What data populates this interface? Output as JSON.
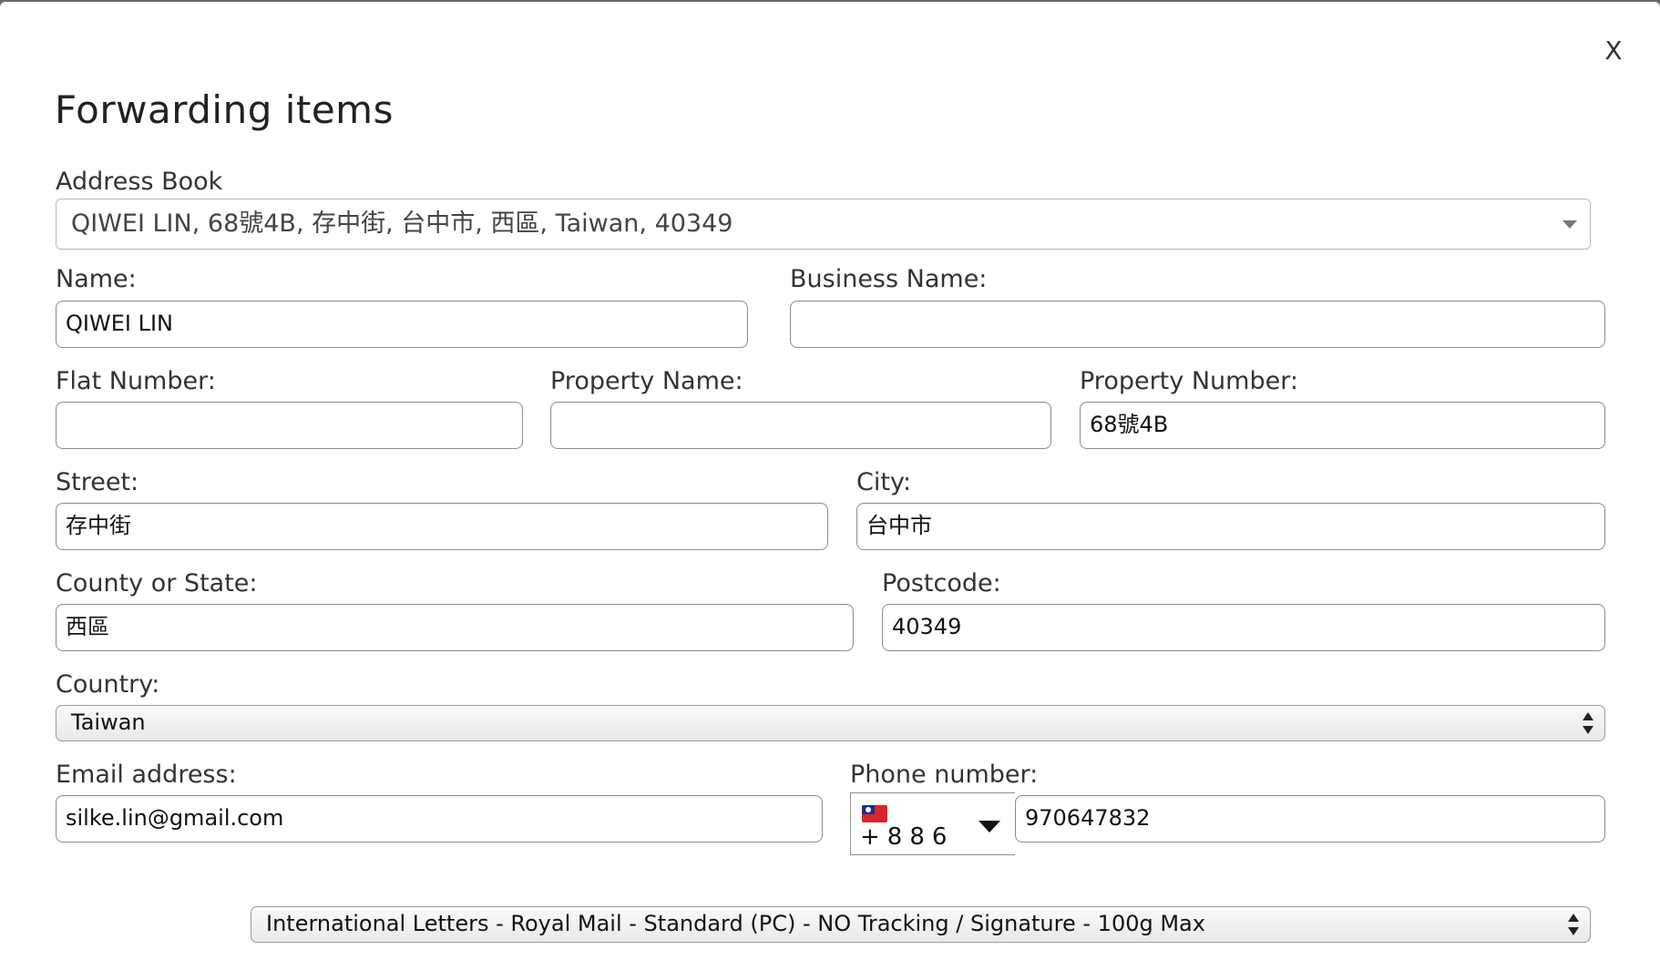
{
  "dialog": {
    "title": "Forwarding items",
    "close_label": "X"
  },
  "address_book": {
    "label": "Address Book",
    "selected": "QIWEI LIN, 68號4B, 存中街, 台中市, 西區, Taiwan, 40349"
  },
  "fields": {
    "name": {
      "label": "Name:",
      "value": "QIWEI LIN"
    },
    "business_name": {
      "label": "Business Name:",
      "value": ""
    },
    "flat_number": {
      "label": "Flat Number:",
      "value": ""
    },
    "property_name": {
      "label": "Property Name:",
      "value": ""
    },
    "property_number": {
      "label": "Property Number:",
      "value": "68號4B"
    },
    "street": {
      "label": "Street:",
      "value": "存中街"
    },
    "city": {
      "label": "City:",
      "value": "台中市"
    },
    "county": {
      "label": "County or State:",
      "value": "西區"
    },
    "postcode": {
      "label": "Postcode:",
      "value": "40349"
    },
    "country": {
      "label": "Country:",
      "selected": "Taiwan"
    },
    "email": {
      "label": "Email address:",
      "value": "silke.lin@gmail.com"
    },
    "phone": {
      "label": "Phone number:",
      "dial_code": "+886",
      "flag_icon": "taiwan-flag-icon",
      "value": "970647832"
    }
  },
  "shipping": {
    "selected": "International Letters - Royal Mail - Standard (PC) - NO Tracking / Signature - 100g Max"
  }
}
